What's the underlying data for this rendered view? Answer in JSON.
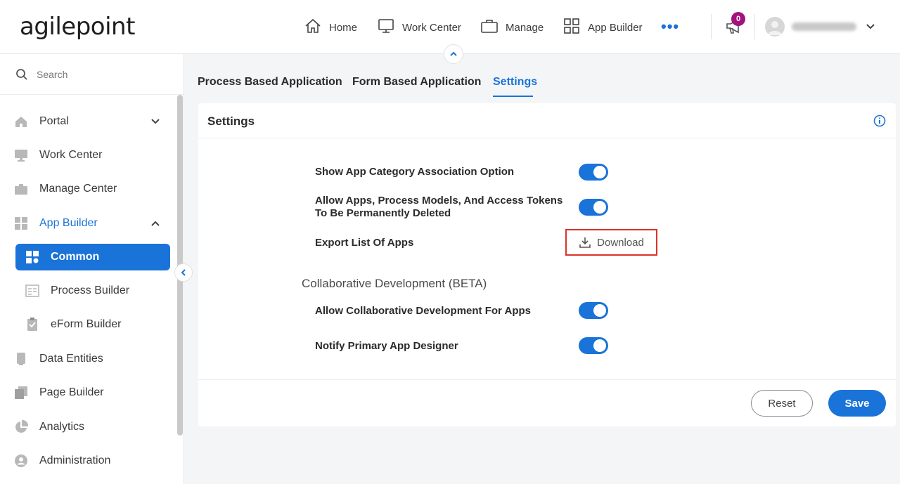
{
  "brand": {
    "logo_text": "agilepoint"
  },
  "header": {
    "nav": [
      {
        "label": "Home",
        "icon": "home-icon"
      },
      {
        "label": "Work Center",
        "icon": "monitor-icon"
      },
      {
        "label": "Manage",
        "icon": "briefcase-icon"
      },
      {
        "label": "App Builder",
        "icon": "grid-icon"
      }
    ],
    "more_icon": "more-dots-icon",
    "notification_count": "0",
    "accent_color": "#1a73d9",
    "badge_color": "#a3127d"
  },
  "sidebar": {
    "search_placeholder": "Search",
    "items": [
      {
        "label": "Portal",
        "icon": "home-icon"
      },
      {
        "label": "Work Center",
        "icon": "monitor-icon"
      },
      {
        "label": "Manage Center",
        "icon": "briefcase-icon"
      },
      {
        "label": "App Builder",
        "icon": "app-builder-icon"
      },
      {
        "label": "Common",
        "icon": "common-icon"
      },
      {
        "label": "Process Builder",
        "icon": "process-builder-icon"
      },
      {
        "label": "eForm Builder",
        "icon": "eform-builder-icon"
      },
      {
        "label": "Data Entities",
        "icon": "data-entities-icon"
      },
      {
        "label": "Page Builder",
        "icon": "page-builder-icon"
      },
      {
        "label": "Analytics",
        "icon": "analytics-icon"
      },
      {
        "label": "Administration",
        "icon": "administration-icon"
      }
    ]
  },
  "tabs": [
    {
      "label": "Process Based Application"
    },
    {
      "label": "Form Based Application"
    },
    {
      "label": "Settings"
    }
  ],
  "panel": {
    "title": "Settings",
    "settings": [
      {
        "label": "Show App Category Association Option",
        "enabled": true
      },
      {
        "label_line1": "Allow Apps, Process Models, And Access Tokens",
        "label_line2": "To Be Permanently Deleted",
        "enabled": true
      },
      {
        "label": "Export List Of Apps",
        "action": "Download"
      }
    ],
    "section_title": "Collaborative Development (BETA)",
    "collab_settings": [
      {
        "label": "Allow Collaborative Development For Apps",
        "enabled": true
      },
      {
        "label": "Notify Primary App Designer",
        "enabled": true
      }
    ],
    "reset_label": "Reset",
    "save_label": "Save"
  }
}
